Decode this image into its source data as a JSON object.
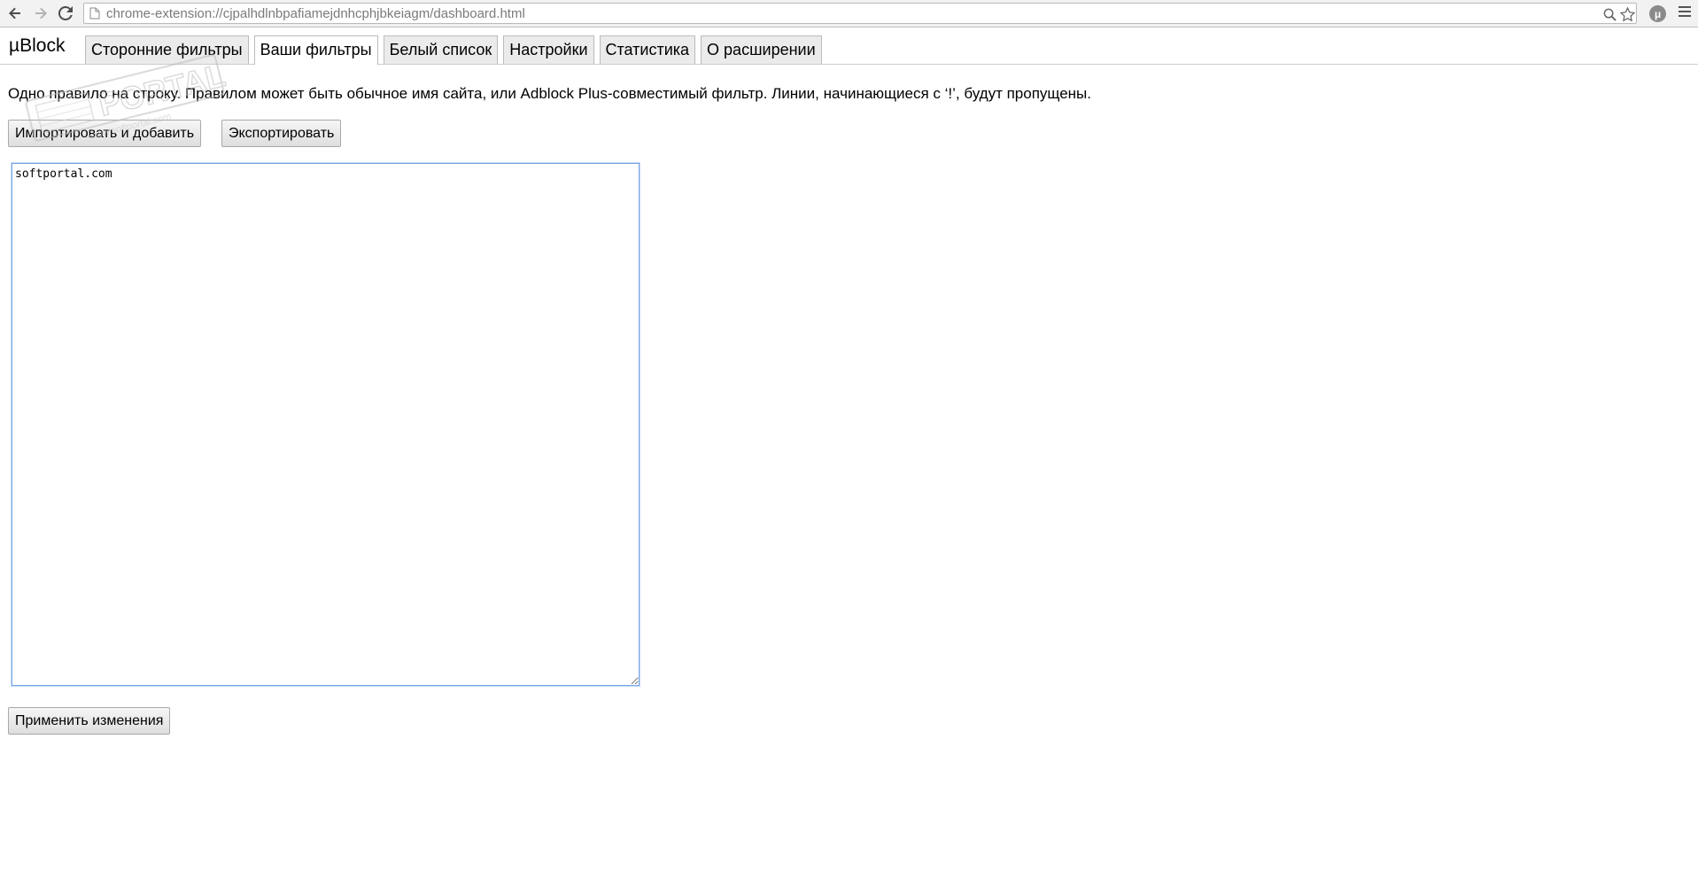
{
  "browser": {
    "url": "chrome-extension://cjpalhdlnbpafiamejdnhcphjbkeiagm/dashboard.html",
    "extension_icon_label": "μ"
  },
  "app": {
    "brand": "µBlock",
    "tabs": [
      {
        "label": "Сторонние фильтры",
        "active": false
      },
      {
        "label": "Ваши фильтры",
        "active": true
      },
      {
        "label": "Белый список",
        "active": false
      },
      {
        "label": "Настройки",
        "active": false
      },
      {
        "label": "Статистика",
        "active": false
      },
      {
        "label": "О расширении",
        "active": false
      }
    ]
  },
  "main": {
    "description": "Одно правило на строку. Правилом может быть обычное имя сайта, или Adblock Plus-совместимый фильтр. Линии, начинающиеся с ‘!’, будут пропущены.",
    "import_button": "Импортировать и добавить",
    "export_button": "Экспортировать",
    "filters_text": "softportal.com",
    "apply_button": "Применить изменения"
  },
  "watermark": {
    "text": "PORTAL",
    "subtext": "www.softportal.com"
  },
  "colors": {
    "toolbar_bg": "#f2f2f2",
    "focus_border": "#7aa7e6",
    "tab_bg": "#ebebeb",
    "active_tab_bg": "#ffffff"
  }
}
